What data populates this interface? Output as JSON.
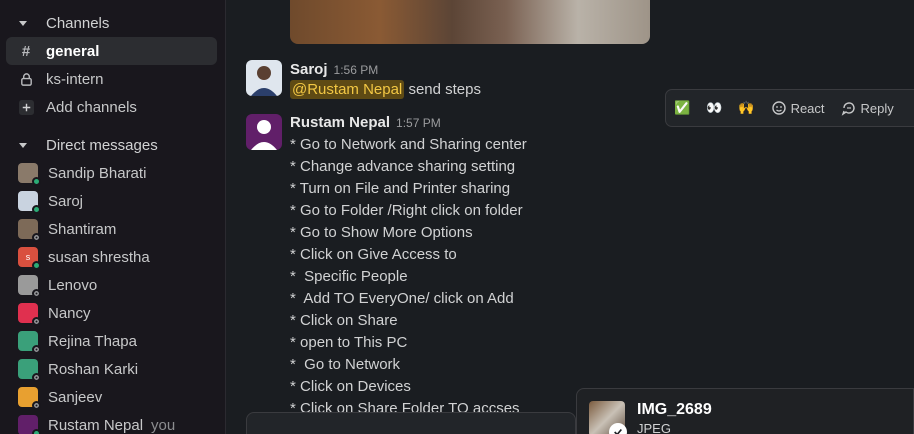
{
  "sidebar": {
    "channels_header": "Channels",
    "channels": [
      {
        "icon": "hash",
        "label": "general",
        "active": true
      },
      {
        "icon": "lock",
        "label": "ks-intern",
        "active": false
      },
      {
        "icon": "plus",
        "label": "Add channels",
        "active": false
      }
    ],
    "dm_header": "Direct messages",
    "dms": [
      {
        "label": "Sandip Bharati",
        "status": "online",
        "avatar_color": "#8a7a6a"
      },
      {
        "label": "Saroj",
        "status": "online",
        "avatar_color": "#c9d3e0"
      },
      {
        "label": "Shantiram",
        "status": "offline",
        "avatar_color": "#7d6a58"
      },
      {
        "label": "susan shrestha",
        "status": "online",
        "avatar_color": "#d9503f",
        "initial": "s"
      },
      {
        "label": "Lenovo",
        "status": "offline",
        "avatar_color": "#9a9a9a"
      },
      {
        "label": "Nancy",
        "status": "offline",
        "avatar_color": "#e0304f"
      },
      {
        "label": "Rejina Thapa",
        "status": "offline",
        "avatar_color": "#3aa07a"
      },
      {
        "label": "Roshan Karki",
        "status": "offline",
        "avatar_color": "#3aa07a"
      },
      {
        "label": "Sanjeev",
        "status": "offline",
        "avatar_color": "#e8a030"
      },
      {
        "label": "Rustam Nepal",
        "status": "online",
        "avatar_color": "#611f69",
        "suffix": "you"
      }
    ]
  },
  "messages": [
    {
      "author": "Saroj",
      "time": "1:56 PM",
      "mention": "@Rustam Nepal",
      "text": " send steps"
    },
    {
      "author": "Rustam Nepal",
      "time": "1:57 PM",
      "lines": [
        "* Go to Network and Sharing center",
        "* Change advance sharing setting",
        "* Turn on File and Printer sharing",
        "* Go to Folder /Right click on folder",
        "* Go to Show More Options",
        "* Click on Give Access to",
        "*  Specific People",
        "*  Add TO EveryOne/ click on Add",
        "* Click on Share",
        "* open to This PC",
        "*  Go to Network",
        "* Click on Devices",
        "* Click on Share Folder TO accses"
      ]
    }
  ],
  "toolbar": {
    "reactions": [
      "✅",
      "👀",
      "🙌"
    ],
    "react_label": "React",
    "reply_label": "Reply"
  },
  "file_popup": {
    "name": "IMG_2689",
    "type": "JPEG"
  }
}
